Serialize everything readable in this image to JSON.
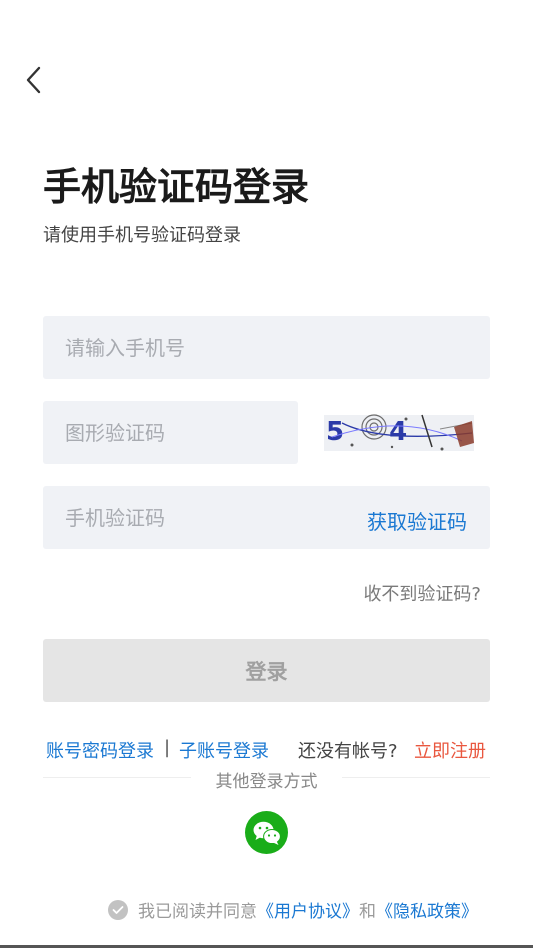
{
  "header": {
    "back_icon": "chevron-left-icon"
  },
  "page": {
    "title": "手机验证码登录",
    "subtitle": "请使用手机号验证码登录"
  },
  "form": {
    "phone_placeholder": "请输入手机号",
    "captcha_placeholder": "图形验证码",
    "captcha_image_text": "5 4",
    "sms_placeholder": "手机验证码",
    "get_code_label": "获取验证码",
    "no_code_label": "收不到验证码?",
    "login_label": "登录"
  },
  "links": {
    "password_login": "账号密码登录",
    "separator": "|",
    "sub_account_login": "子账号登录",
    "no_account_prompt": "还没有帐号?",
    "register_now": "立即注册"
  },
  "other_login": {
    "label": "其他登录方式",
    "wechat_icon": "wechat-icon"
  },
  "agreement": {
    "prefix": "我已阅读并同意",
    "user_agreement": "《用户协议》",
    "and": "和",
    "privacy_policy": "《隐私政策》"
  },
  "colors": {
    "accent_blue": "#1a78d2",
    "register_red": "#e9573f",
    "wechat_green": "#1aad19",
    "field_bg": "#f0f2f6",
    "disabled_button": "#e5e5e5"
  }
}
